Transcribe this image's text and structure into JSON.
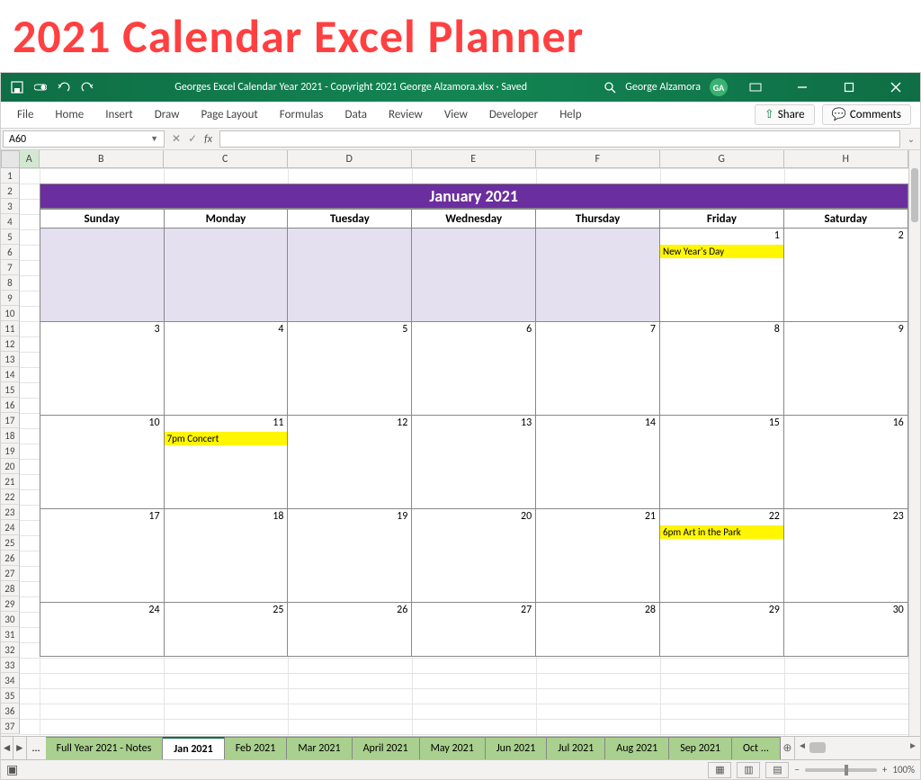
{
  "banner": "2021 Calendar Excel Planner",
  "titlebar": {
    "doc": "Georges Excel Calendar Year 2021 - Copyright 2021 George Alzamora.xlsx  ·  Saved",
    "user": "George Alzamora",
    "initials": "GA"
  },
  "ribbon": {
    "tabs": [
      "File",
      "Home",
      "Insert",
      "Draw",
      "Page Layout",
      "Formulas",
      "Data",
      "Review",
      "View",
      "Developer",
      "Help"
    ],
    "share": "Share",
    "comments": "Comments"
  },
  "namebox": "A60",
  "colheads": [
    "A",
    "B",
    "C",
    "D",
    "E",
    "F",
    "G",
    "H"
  ],
  "rows_visible": 37,
  "calendar": {
    "title": "January 2021",
    "days": [
      "Sunday",
      "Monday",
      "Tuesday",
      "Wednesday",
      "Thursday",
      "Friday",
      "Saturday"
    ],
    "weeks": [
      [
        {
          "pad": true
        },
        {
          "pad": true
        },
        {
          "pad": true
        },
        {
          "pad": true
        },
        {
          "pad": true
        },
        {
          "num": "1",
          "event": "New Year's Day"
        },
        {
          "num": "2"
        }
      ],
      [
        {
          "num": "3"
        },
        {
          "num": "4"
        },
        {
          "num": "5"
        },
        {
          "num": "6"
        },
        {
          "num": "7"
        },
        {
          "num": "8"
        },
        {
          "num": "9"
        }
      ],
      [
        {
          "num": "10"
        },
        {
          "num": "11",
          "event": "7pm Concert"
        },
        {
          "num": "12"
        },
        {
          "num": "13"
        },
        {
          "num": "14"
        },
        {
          "num": "15"
        },
        {
          "num": "16"
        }
      ],
      [
        {
          "num": "17"
        },
        {
          "num": "18"
        },
        {
          "num": "19"
        },
        {
          "num": "20"
        },
        {
          "num": "21"
        },
        {
          "num": "22",
          "event": "6pm Art in the Park"
        },
        {
          "num": "23"
        }
      ],
      [
        {
          "num": "24"
        },
        {
          "num": "25"
        },
        {
          "num": "26"
        },
        {
          "num": "27"
        },
        {
          "num": "28"
        },
        {
          "num": "29"
        },
        {
          "num": "30"
        }
      ]
    ]
  },
  "sheets": {
    "prefix_etc": "...",
    "tabs": [
      "Full Year 2021 - Notes",
      "Jan 2021",
      "Feb 2021",
      "Mar 2021",
      "April 2021",
      "May 2021",
      "Jun 2021",
      "Jul 2021",
      "Aug 2021",
      "Sep 2021",
      "Oct ..."
    ],
    "active_index": 1
  },
  "statusbar": {
    "zoom": "100%"
  }
}
